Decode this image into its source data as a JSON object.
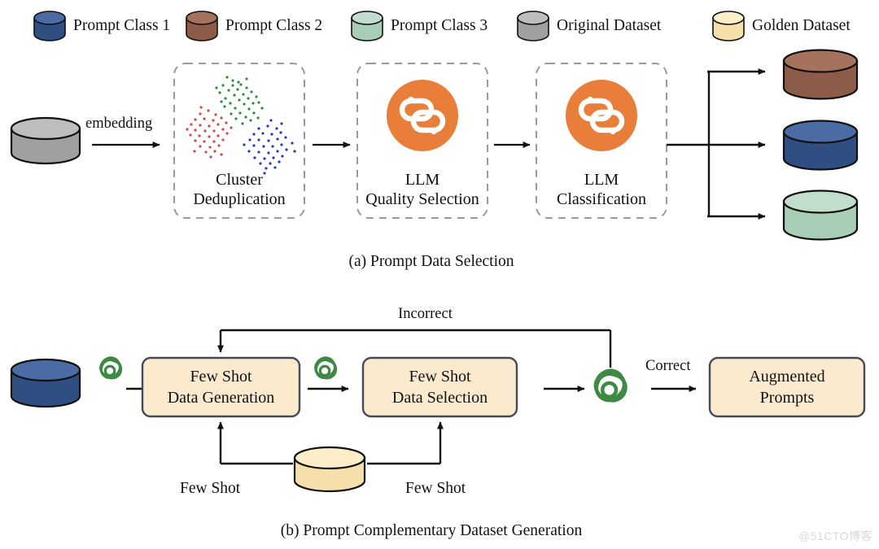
{
  "figure": {
    "watermark": "@51CTO博客"
  },
  "legend": {
    "items": [
      {
        "label": "Prompt Class 1",
        "icon": "cylinder-icon",
        "color": "#2f4f82",
        "top": "#4a6ba4"
      },
      {
        "label": "Prompt Class 2",
        "icon": "cylinder-icon",
        "color": "#8d5c48",
        "top": "#a5725d"
      },
      {
        "label": "Prompt Class 3",
        "icon": "cylinder-icon",
        "color": "#a8ceb8",
        "top": "#c3ddcd"
      },
      {
        "label": "Original Dataset",
        "icon": "cylinder-icon",
        "color": "#a0a0a0",
        "top": "#bdbdbd"
      },
      {
        "label": "Golden Dataset",
        "icon": "cylinder-icon",
        "color": "#f6dfab",
        "top": "#fbeec9"
      }
    ]
  },
  "panel_a": {
    "caption": "(a) Prompt Data Selection",
    "input_dataset": {
      "name": "Original Dataset",
      "color": "#a0a0a0",
      "top": "#bdbdbd"
    },
    "edge_labels": {
      "embedding": "embedding"
    },
    "stages": [
      {
        "id": "cluster-dedup",
        "line1": "Cluster",
        "line2": "Deduplication",
        "icon": "scatter-cluster-icon"
      },
      {
        "id": "llm-quality",
        "line1": "LLM",
        "line2": "Quality Selection",
        "icon": "llm-icon"
      },
      {
        "id": "llm-classification",
        "line1": "LLM",
        "line2": "Classification",
        "icon": "llm-icon"
      }
    ],
    "clusters": [
      {
        "name": "green-cluster",
        "color": "#2e8b3d"
      },
      {
        "name": "red-cluster",
        "color": "#cc4b44"
      },
      {
        "name": "blue-cluster",
        "color": "#2a35c8"
      }
    ],
    "outputs": [
      {
        "label": "Prompt Class 2",
        "color": "#8d5c48",
        "top": "#a5725d"
      },
      {
        "label": "Prompt Class 1",
        "color": "#2f4f82",
        "top": "#4a6ba4"
      },
      {
        "label": "Prompt Class 3",
        "color": "#a8ceb8",
        "top": "#c3ddcd"
      }
    ]
  },
  "panel_b": {
    "caption": "(b) Prompt Complementary Dataset Generation",
    "input_dataset": {
      "name": "Prompt Class 1",
      "color": "#2f4f82",
      "top": "#4a6ba4"
    },
    "golden_dataset": {
      "name": "Golden Dataset",
      "color": "#f6dfab",
      "top": "#fbeec9"
    },
    "boxes": [
      {
        "id": "few-shot-generation",
        "line1": "Few Shot",
        "line2": "Data Generation"
      },
      {
        "id": "few-shot-selection",
        "line1": "Few Shot",
        "line2": "Data Selection"
      },
      {
        "id": "augmented-prompts",
        "line1": "Augmented",
        "line2": "Prompts"
      }
    ],
    "edge_labels": {
      "incorrect": "Incorrect",
      "correct": "Correct",
      "few_shot_left": "Few Shot",
      "few_shot_right": "Few Shot"
    },
    "agents": [
      {
        "name": "openai-agent-icon-1",
        "color": "#3e8a45"
      },
      {
        "name": "openai-agent-icon-2",
        "color": "#3e8a45"
      },
      {
        "name": "openai-validator-icon",
        "color": "#3e8a45"
      }
    ]
  },
  "colors": {
    "box_fill": "#fbeacd",
    "box_stroke": "#424a5c",
    "dashed_stroke": "#9a9a9a",
    "arrow": "#111111",
    "llm_orange": "#e87e39",
    "agent_green": "#3e8a45"
  }
}
